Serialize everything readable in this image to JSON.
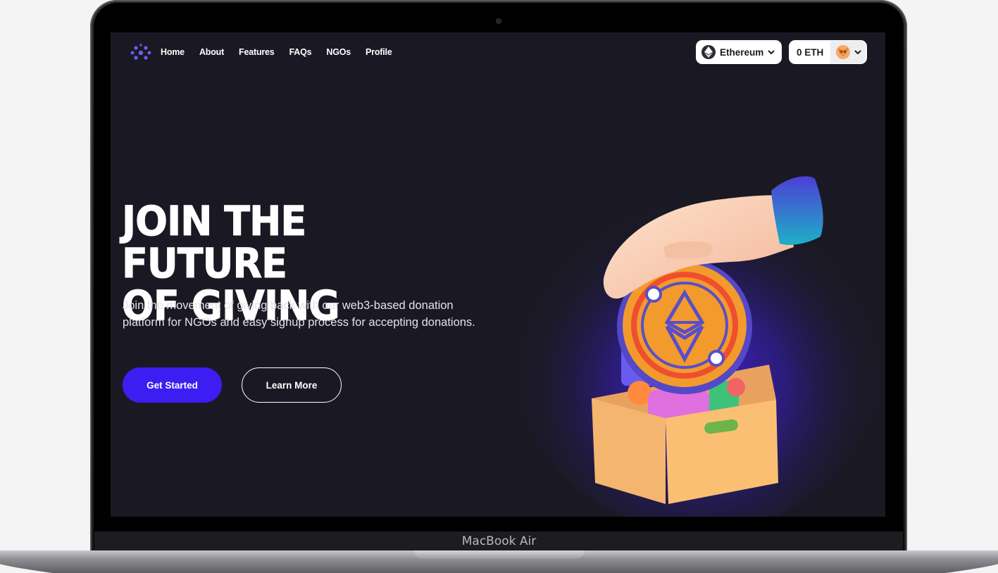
{
  "device": {
    "label": "MacBook Air"
  },
  "nav": {
    "links": [
      "Home",
      "About",
      "Features",
      "FAQs",
      "NGOs",
      "Profile"
    ]
  },
  "chain_select": {
    "label": "Ethereum",
    "icon": "ethereum-icon"
  },
  "wallet": {
    "balance": "0 ETH",
    "avatar_icon": "fox-avatar-icon"
  },
  "hero": {
    "title_line1": "Join the future",
    "title_line2": "of giving",
    "subtitle": "Join the movement of giving back with our web3-based donation platform for NGOs and easy signup process for accepting donations.",
    "primary_button": "Get Started",
    "secondary_button": "Learn More"
  },
  "colors": {
    "background": "#1a1923",
    "accent": "#3d1df2",
    "logo": "#6b5cf6",
    "glow": "#3a1fc2"
  }
}
